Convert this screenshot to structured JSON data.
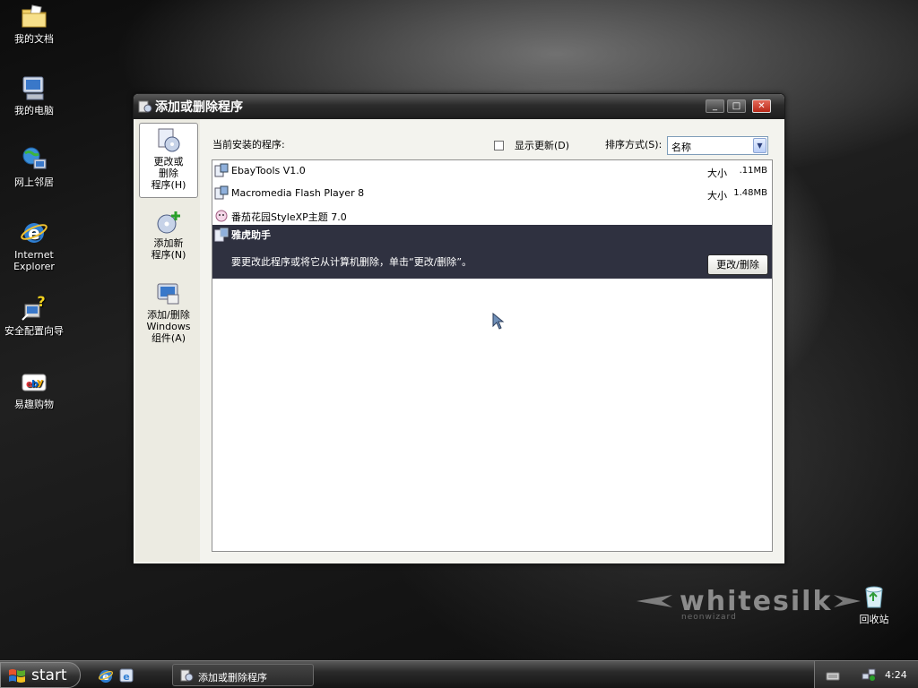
{
  "desktop": {
    "icons": [
      {
        "label": "我的文档",
        "icon": "folder-documents-icon"
      },
      {
        "label": "我的电脑",
        "icon": "my-computer-icon"
      },
      {
        "label": "网上邻居",
        "icon": "network-places-icon"
      },
      {
        "label": "Internet\nExplorer",
        "label_line1": "Internet",
        "label_line2": "Explorer",
        "icon": "internet-explorer-icon"
      },
      {
        "label": "安全配置向导",
        "icon": "security-wizard-icon"
      },
      {
        "label": "易趣购物",
        "icon": "ebay-shopping-icon"
      }
    ],
    "recycle_bin": {
      "label": "回收站",
      "icon": "recycle-bin-icon"
    },
    "wallpaper_logo": {
      "text": "whitesilk",
      "subtext": "neonwizard"
    }
  },
  "window": {
    "title": "添加或删除程序",
    "controls": {
      "minimize": "_",
      "maximize": "□",
      "close": "✕"
    },
    "left_pane": {
      "items": [
        {
          "label_line1": "更改或",
          "label_line2": "删除",
          "label_line3": "程序(H)",
          "icon": "change-remove-programs-icon",
          "active": true
        },
        {
          "label_line1": "添加新",
          "label_line2": "程序(N)",
          "icon": "add-new-programs-icon",
          "active": false
        },
        {
          "label_line1": "添加/删除",
          "label_line2": "Windows",
          "label_line3": "组件(A)",
          "icon": "windows-components-icon",
          "active": false
        }
      ]
    },
    "header": {
      "current_programs_label": "当前安装的程序:",
      "show_updates_label": "显示更新(D)",
      "show_updates_checked": false,
      "sort_label": "排序方式(S):",
      "sort_value": "名称"
    },
    "programs": [
      {
        "name": "EbayTools V1.0",
        "size_label": "大小",
        "size": ".11MB",
        "icon": "installer-icon"
      },
      {
        "name": "Macromedia Flash Player 8",
        "size_label": "大小",
        "size": "1.48MB",
        "icon": "installer-icon"
      },
      {
        "name": "番茄花园StyleXP主题 7.0",
        "size_label": "",
        "size": "",
        "icon": "tomato-theme-icon"
      },
      {
        "name": "雅虎助手",
        "description": "要更改此程序或将它从计算机删除，单击“更改/删除”。",
        "button_label": "更改/删除",
        "icon": "installer-icon",
        "selected": true
      }
    ]
  },
  "taskbar": {
    "start_label": "start",
    "task_title": "添加或删除程序",
    "clock": "4:24"
  },
  "colors": {
    "selection_bg": "#2f3140",
    "close_button": "#c8321f"
  }
}
